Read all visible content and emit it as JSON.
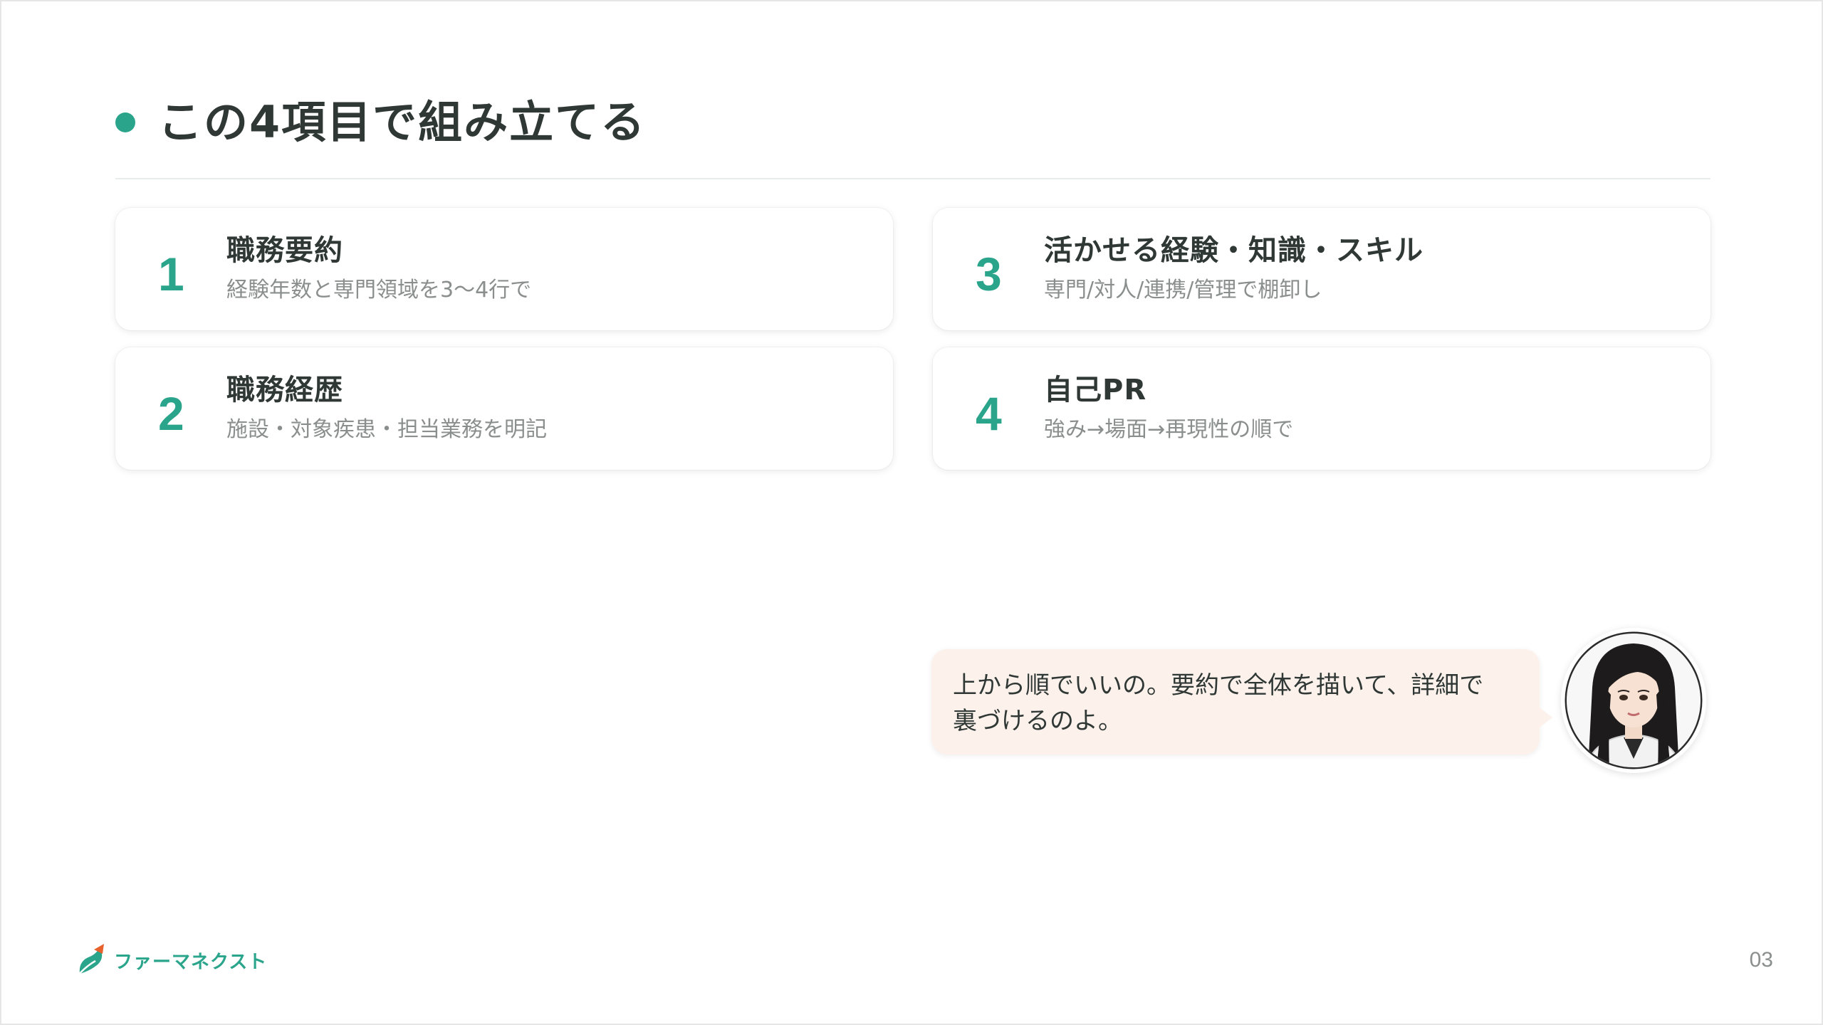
{
  "slide": {
    "title": "この4項目で組み立てる",
    "page_number": "03"
  },
  "cards": [
    {
      "number": "1",
      "title": "職務要約",
      "subtitle": "経験年数と専門領域を3〜4行で"
    },
    {
      "number": "3",
      "title": "活かせる経験・知識・スキル",
      "subtitle": "専門/対人/連携/管理で棚卸し"
    },
    {
      "number": "2",
      "title": "職務経歴",
      "subtitle": "施設・対象疾患・担当業務を明記"
    },
    {
      "number": "4",
      "title": "自己PR",
      "subtitle": "強み→場面→再現性の順で"
    }
  ],
  "speech": {
    "line1": "上から順でいいの。要約で全体を描いて、詳細で",
    "line2": "裏づけるのよ。"
  },
  "brand": {
    "name": "ファーマネクスト",
    "accent_color": "#2aa58b",
    "bubble_color": "#fdf1ec"
  }
}
